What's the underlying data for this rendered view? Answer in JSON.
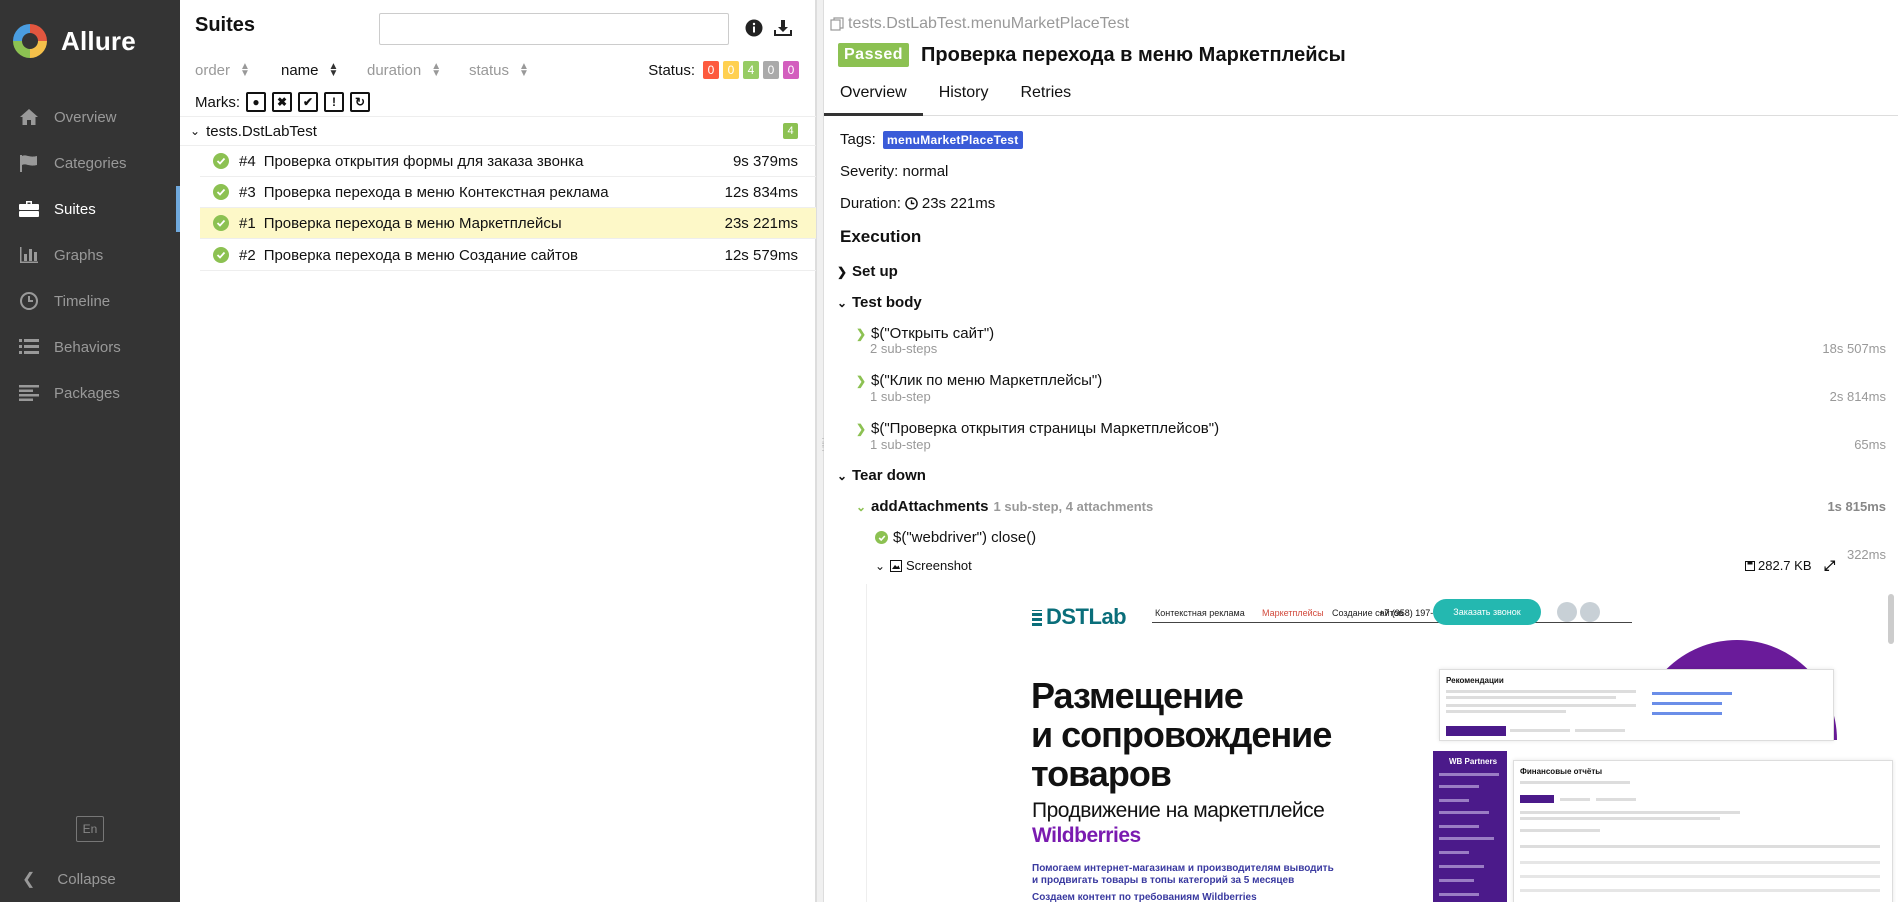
{
  "app": {
    "name": "Allure"
  },
  "sidebar": {
    "items": [
      {
        "label": "Overview",
        "icon": "home-icon"
      },
      {
        "label": "Categories",
        "icon": "flag-icon"
      },
      {
        "label": "Suites",
        "icon": "briefcase-icon"
      },
      {
        "label": "Graphs",
        "icon": "bar-chart-icon"
      },
      {
        "label": "Timeline",
        "icon": "clock-icon"
      },
      {
        "label": "Behaviors",
        "icon": "list-icon"
      },
      {
        "label": "Packages",
        "icon": "align-left-icon"
      }
    ],
    "active": "Suites",
    "lang": "En",
    "collapse": "Collapse"
  },
  "suites": {
    "title": "Suites",
    "search": {
      "value": "",
      "placeholder": ""
    },
    "sort": {
      "order": "order",
      "name": "name",
      "duration": "duration",
      "status": "status",
      "active": "name"
    },
    "status_label": "Status:",
    "status_counts": [
      {
        "value": "0",
        "color": "#fd5a3e"
      },
      {
        "value": "0",
        "color": "#ffd050"
      },
      {
        "value": "4",
        "color": "#97cc64"
      },
      {
        "value": "0",
        "color": "#aaaaaa"
      },
      {
        "value": "0",
        "color": "#d35ebe"
      }
    ],
    "marks_label": "Marks:",
    "group": {
      "name": "tests.DstLabTest",
      "count": "4"
    },
    "tests": [
      {
        "num": "#4",
        "name": "Проверка открытия формы для заказа звонка",
        "duration": "9s 379ms",
        "selected": false
      },
      {
        "num": "#3",
        "name": "Проверка перехода в меню Контекстная реклама",
        "duration": "12s 834ms",
        "selected": false
      },
      {
        "num": "#1",
        "name": "Проверка перехода в меню Маркетплейсы",
        "duration": "23s 221ms",
        "selected": true
      },
      {
        "num": "#2",
        "name": "Проверка перехода в меню Создание сайтов",
        "duration": "12s 579ms",
        "selected": false
      }
    ]
  },
  "detail": {
    "path": "tests.DstLabTest.menuMarketPlaceTest",
    "status": "Passed",
    "title": "Проверка перехода в меню Маркетплейсы",
    "tabs": [
      "Overview",
      "History",
      "Retries"
    ],
    "active_tab": "Overview",
    "tags_label": "Tags:",
    "tag": "menuMarketPlaceTest",
    "severity_label": "Severity:",
    "severity": "normal",
    "duration_label": "Duration:",
    "duration": "23s 221ms",
    "execution_title": "Execution",
    "setup": "Set up",
    "test_body": "Test body",
    "steps": [
      {
        "name": "$(\"Открыть сайт\")",
        "sub": "2 sub-steps",
        "duration": "18s 507ms"
      },
      {
        "name": "$(\"Клик по меню Маркетплейсы\")",
        "sub": "1 sub-step",
        "duration": "2s 814ms"
      },
      {
        "name": "$(\"Проверка открытия страницы Маркетплейсов\")",
        "sub": "1 sub-step",
        "duration": "65ms"
      }
    ],
    "teardown": "Tear down",
    "attach_step": {
      "name": "addAttachments",
      "meta": "1 sub-step, 4 attachments",
      "duration": "1s 815ms"
    },
    "close_step": {
      "name": "$(\"webdriver\") close()",
      "duration": "322ms"
    },
    "screenshot": {
      "name": "Screenshot",
      "size": "282.7 KB"
    }
  },
  "screenshot_page": {
    "menu": [
      "Контекстная реклама",
      "Маркетплейсы",
      "Создание сайтов"
    ],
    "phone": "+7 (958) 197-77-10",
    "cta": "Заказать звонок",
    "h1_lines": [
      "Размещение",
      "и сопровождение",
      "товаров"
    ],
    "h2": "Продвижение на маркетплейсе",
    "h3": "Wildberries",
    "p1": "Помогаем интернет-магазинам и производителям выводить",
    "p1b": "и продвигать товары в топы категорий за 5 месяцев",
    "p2": "Создаем контент по требованиям Wildberries",
    "card1_title": "Рекомендации",
    "card2_title": "Финансовые отчёты",
    "side_title": "WB Partners"
  }
}
